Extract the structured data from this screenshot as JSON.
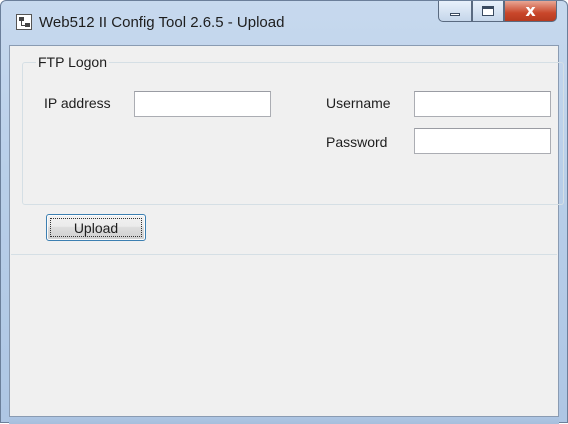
{
  "window": {
    "title": "Web512 II Config Tool 2.6.5 - Upload",
    "icon": "network-computer-icon",
    "controls": {
      "minimize_icon": "minimize-icon",
      "maximize_icon": "maximize-icon",
      "close_glyph": "x"
    }
  },
  "ftp_logon": {
    "legend": "FTP Logon",
    "ip_address": {
      "label": "IP address",
      "value": ""
    },
    "username": {
      "label": "Username",
      "value": ""
    },
    "password": {
      "label": "Password",
      "value": ""
    }
  },
  "actions": {
    "upload_label": "Upload"
  },
  "log": {
    "text": ""
  }
}
